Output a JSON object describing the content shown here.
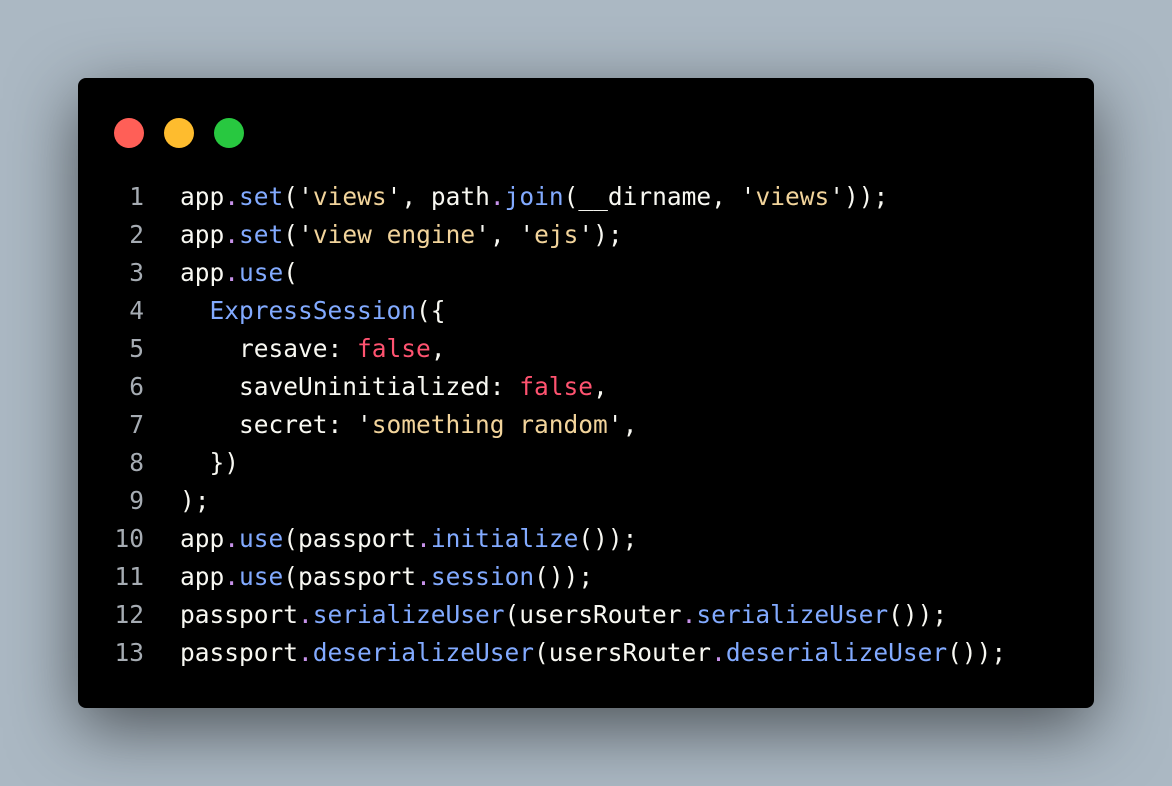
{
  "colors": {
    "background": "#abb8c3",
    "window": "#000000",
    "dot_close": "#ff5f57",
    "dot_minimize": "#febc2e",
    "dot_maximize": "#28c840",
    "line_number": "#a6acb3",
    "plain": "#f8f8f2",
    "function": "#82aaff",
    "string": "#f2d49b",
    "boolean": "#ff5370",
    "dot_operator": "#c792ea"
  },
  "code_lines": [
    {
      "n": "1",
      "tokens": [
        {
          "t": "app",
          "k": "plain"
        },
        {
          "t": ".",
          "k": "punct"
        },
        {
          "t": "set",
          "k": "fn"
        },
        {
          "t": "(",
          "k": "plain"
        },
        {
          "t": "'",
          "k": "plain"
        },
        {
          "t": "views",
          "k": "str"
        },
        {
          "t": "'",
          "k": "plain"
        },
        {
          "t": ", path",
          "k": "plain"
        },
        {
          "t": ".",
          "k": "punct"
        },
        {
          "t": "join",
          "k": "fn"
        },
        {
          "t": "(__dirname, ",
          "k": "plain"
        },
        {
          "t": "'",
          "k": "plain"
        },
        {
          "t": "views",
          "k": "str"
        },
        {
          "t": "'",
          "k": "plain"
        },
        {
          "t": "));",
          "k": "plain"
        }
      ]
    },
    {
      "n": "2",
      "tokens": [
        {
          "t": "app",
          "k": "plain"
        },
        {
          "t": ".",
          "k": "punct"
        },
        {
          "t": "set",
          "k": "fn"
        },
        {
          "t": "(",
          "k": "plain"
        },
        {
          "t": "'",
          "k": "plain"
        },
        {
          "t": "view engine",
          "k": "str"
        },
        {
          "t": "'",
          "k": "plain"
        },
        {
          "t": ", ",
          "k": "plain"
        },
        {
          "t": "'",
          "k": "plain"
        },
        {
          "t": "ejs",
          "k": "str"
        },
        {
          "t": "'",
          "k": "plain"
        },
        {
          "t": ");",
          "k": "plain"
        }
      ]
    },
    {
      "n": "3",
      "tokens": [
        {
          "t": "app",
          "k": "plain"
        },
        {
          "t": ".",
          "k": "punct"
        },
        {
          "t": "use",
          "k": "fn"
        },
        {
          "t": "(",
          "k": "plain"
        }
      ]
    },
    {
      "n": "4",
      "tokens": [
        {
          "t": "  ",
          "k": "plain"
        },
        {
          "t": "ExpressSession",
          "k": "fn"
        },
        {
          "t": "({",
          "k": "plain"
        }
      ]
    },
    {
      "n": "5",
      "tokens": [
        {
          "t": "    resave: ",
          "k": "plain"
        },
        {
          "t": "false",
          "k": "bool"
        },
        {
          "t": ",",
          "k": "plain"
        }
      ]
    },
    {
      "n": "6",
      "tokens": [
        {
          "t": "    saveUninitialized: ",
          "k": "plain"
        },
        {
          "t": "false",
          "k": "bool"
        },
        {
          "t": ",",
          "k": "plain"
        }
      ]
    },
    {
      "n": "7",
      "tokens": [
        {
          "t": "    secret: ",
          "k": "plain"
        },
        {
          "t": "'",
          "k": "plain"
        },
        {
          "t": "something random",
          "k": "str"
        },
        {
          "t": "'",
          "k": "plain"
        },
        {
          "t": ",",
          "k": "plain"
        }
      ]
    },
    {
      "n": "8",
      "tokens": [
        {
          "t": "  })",
          "k": "plain"
        }
      ]
    },
    {
      "n": "9",
      "tokens": [
        {
          "t": ");",
          "k": "plain"
        }
      ]
    },
    {
      "n": "10",
      "tokens": [
        {
          "t": "app",
          "k": "plain"
        },
        {
          "t": ".",
          "k": "punct"
        },
        {
          "t": "use",
          "k": "fn"
        },
        {
          "t": "(passport",
          "k": "plain"
        },
        {
          "t": ".",
          "k": "punct"
        },
        {
          "t": "initialize",
          "k": "fn"
        },
        {
          "t": "());",
          "k": "plain"
        }
      ]
    },
    {
      "n": "11",
      "tokens": [
        {
          "t": "app",
          "k": "plain"
        },
        {
          "t": ".",
          "k": "punct"
        },
        {
          "t": "use",
          "k": "fn"
        },
        {
          "t": "(passport",
          "k": "plain"
        },
        {
          "t": ".",
          "k": "punct"
        },
        {
          "t": "session",
          "k": "fn"
        },
        {
          "t": "());",
          "k": "plain"
        }
      ]
    },
    {
      "n": "12",
      "tokens": [
        {
          "t": "passport",
          "k": "plain"
        },
        {
          "t": ".",
          "k": "punct"
        },
        {
          "t": "serializeUser",
          "k": "fn"
        },
        {
          "t": "(usersRouter",
          "k": "plain"
        },
        {
          "t": ".",
          "k": "punct"
        },
        {
          "t": "serializeUser",
          "k": "fn"
        },
        {
          "t": "());",
          "k": "plain"
        }
      ]
    },
    {
      "n": "13",
      "tokens": [
        {
          "t": "passport",
          "k": "plain"
        },
        {
          "t": ".",
          "k": "punct"
        },
        {
          "t": "deserializeUser",
          "k": "fn"
        },
        {
          "t": "(usersRouter",
          "k": "plain"
        },
        {
          "t": ".",
          "k": "punct"
        },
        {
          "t": "deserializeUser",
          "k": "fn"
        },
        {
          "t": "());",
          "k": "plain"
        }
      ]
    }
  ]
}
